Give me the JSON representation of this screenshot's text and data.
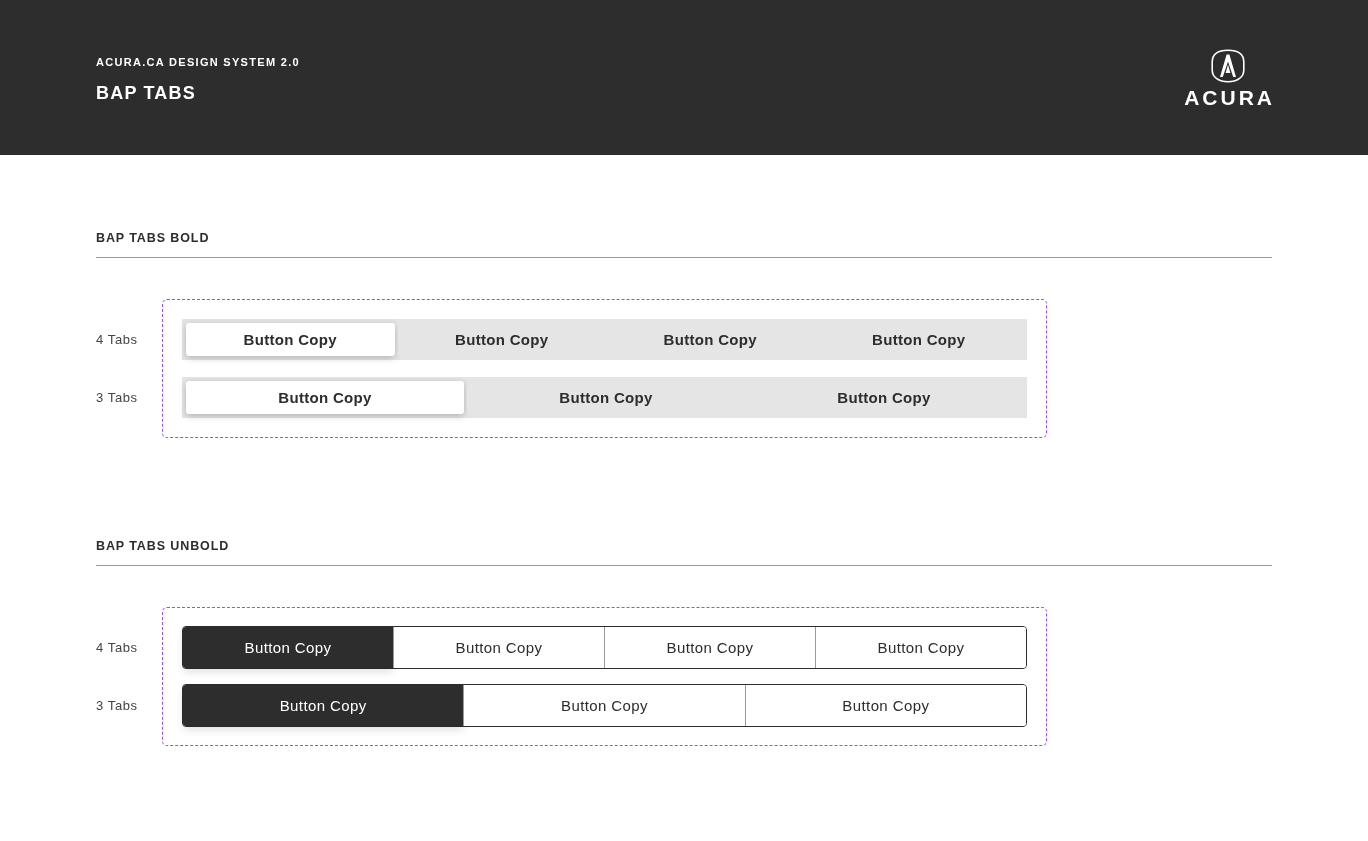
{
  "header": {
    "eyebrow": "ACURA.CA DESIGN SYSTEM 2.0",
    "title": "BAP TABS",
    "logo": {
      "wordmark": "ACURA"
    }
  },
  "sections": [
    {
      "title": "BAP TABS BOLD",
      "kind": "bold",
      "rows": [
        {
          "label": "4 Tabs",
          "tabs": [
            {
              "label": "Button Copy",
              "selected": true
            },
            {
              "label": "Button Copy",
              "selected": false
            },
            {
              "label": "Button Copy",
              "selected": false
            },
            {
              "label": "Button Copy",
              "selected": false
            }
          ]
        },
        {
          "label": "3 Tabs",
          "tabs": [
            {
              "label": "Button Copy",
              "selected": true
            },
            {
              "label": "Button Copy",
              "selected": false
            },
            {
              "label": "Button Copy",
              "selected": false
            }
          ]
        }
      ]
    },
    {
      "title": "BAP TABS UNBOLD",
      "kind": "outline",
      "rows": [
        {
          "label": "4 Tabs",
          "tabs": [
            {
              "label": "Button Copy",
              "selected": true
            },
            {
              "label": "Button Copy",
              "selected": false
            },
            {
              "label": "Button Copy",
              "selected": false
            },
            {
              "label": "Button Copy",
              "selected": false
            }
          ]
        },
        {
          "label": "3 Tabs",
          "tabs": [
            {
              "label": "Button Copy",
              "selected": true
            },
            {
              "label": "Button Copy",
              "selected": false
            },
            {
              "label": "Button Copy",
              "selected": false
            }
          ]
        }
      ]
    }
  ]
}
